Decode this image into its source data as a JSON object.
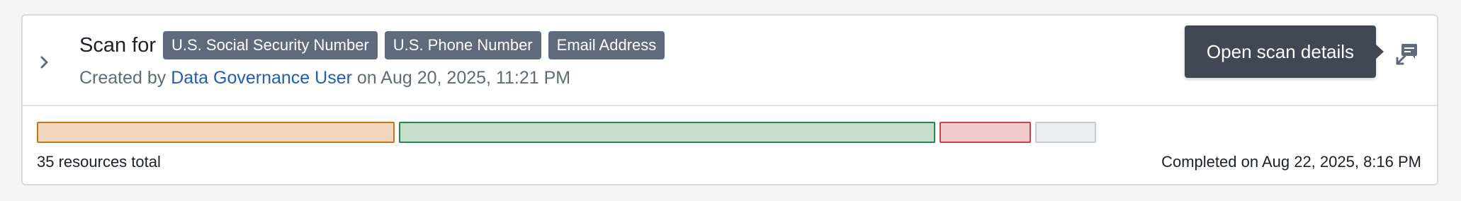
{
  "scan": {
    "title_prefix": "Scan for",
    "tags": [
      "U.S. Social Security Number",
      "U.S. Phone Number",
      "Email Address"
    ],
    "created_prefix": "Created by",
    "created_by": "Data Governance User",
    "created_on_prefix": "on",
    "created_on": "Aug 20, 2025, 11:21 PM"
  },
  "tooltip": {
    "text": "Open scan details"
  },
  "icons": {
    "expand": "chevron-right-icon",
    "details": "open-details-icon"
  },
  "progress": {
    "segments": [
      {
        "status": "orange",
        "fraction": 0.258,
        "fill": "#f0d5c0",
        "border": "#c87619"
      },
      {
        "status": "green",
        "fraction": 0.387,
        "fill": "#c6ddca",
        "border": "#238551"
      },
      {
        "status": "red",
        "fraction": 0.066,
        "fill": "#efcbcc",
        "border": "#cd4246"
      },
      {
        "status": "gray",
        "fraction": 0.044,
        "fill": "#eceef0",
        "border": "#c5cbd3"
      }
    ]
  },
  "footer": {
    "total": "35 resources total",
    "completed": "Completed on Aug 22, 2025, 8:16 PM"
  }
}
